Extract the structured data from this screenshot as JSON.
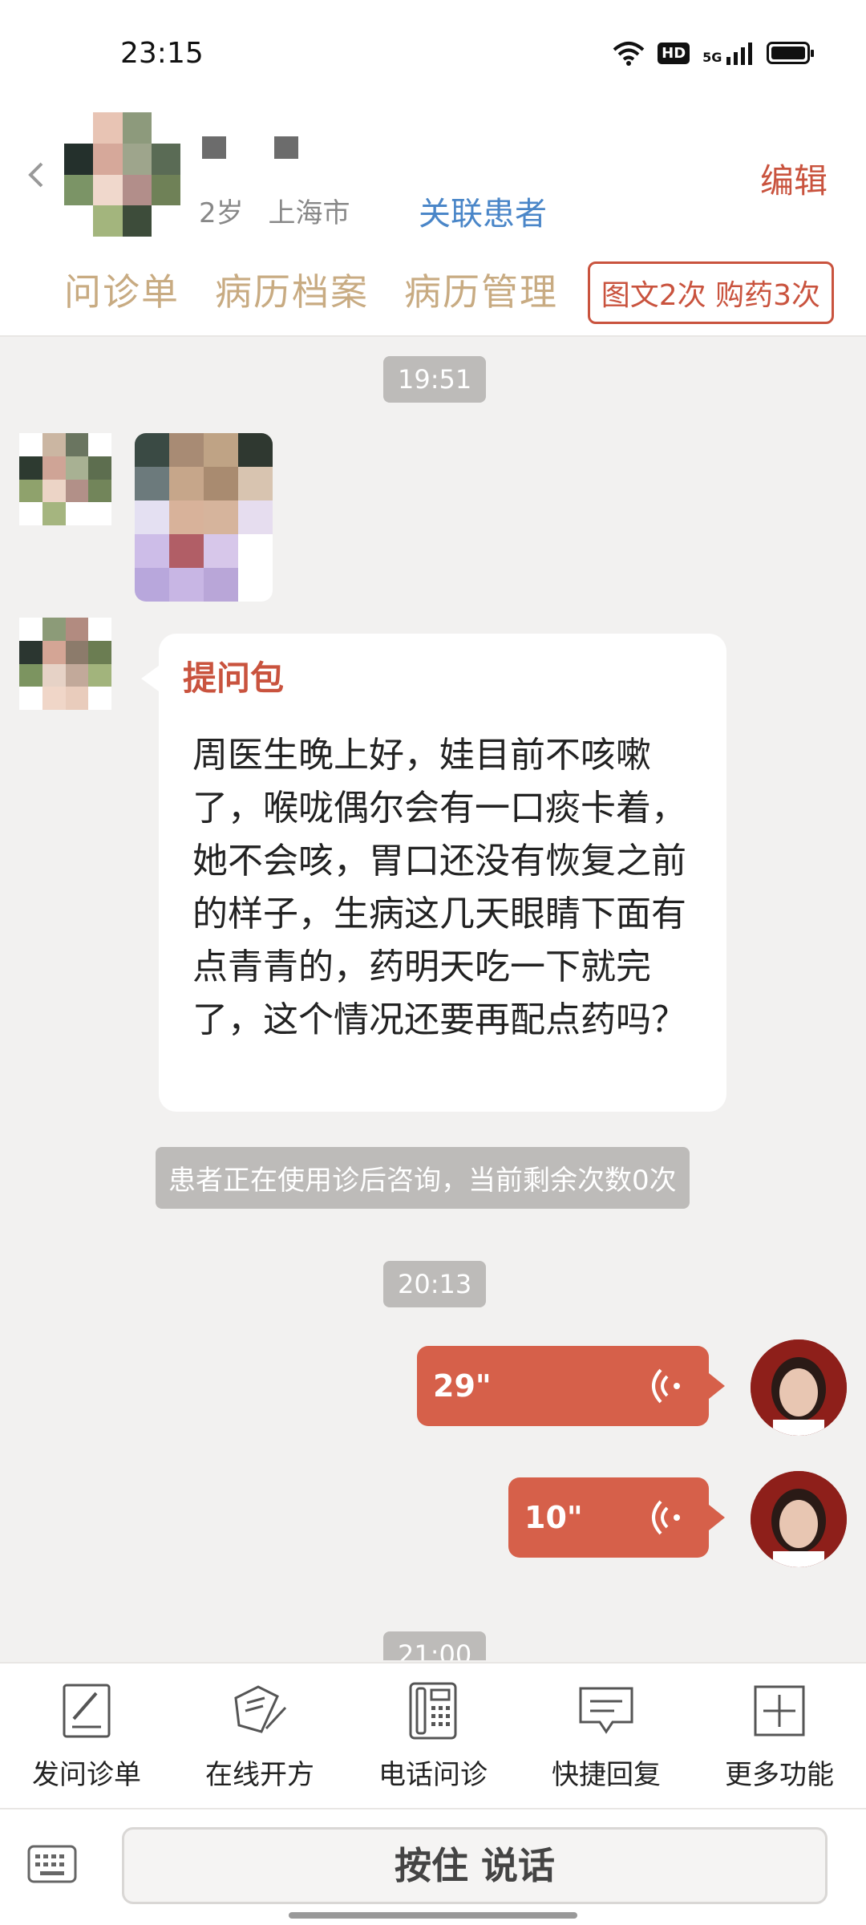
{
  "status_bar": {
    "time": "23:15",
    "hd": "HD",
    "network": "5G"
  },
  "header": {
    "age": "2岁",
    "city": "上海市",
    "link_patient": "关联患者",
    "edit": "编辑",
    "tabs": [
      "问诊单",
      "病历档案",
      "病历管理"
    ],
    "usage_tag": "图文2次 购药3次"
  },
  "chat": {
    "ts1": "19:51",
    "question_title": "提问包",
    "question_text": "周医生晚上好，娃目前不咳嗽了，喉咙偶尔会有一口痰卡着，她不会咳，胃口还没有恢复之前的样子，生病这几天眼睛下面有点青青的，药明天吃一下就完了，这个情况还要再配点药吗？",
    "system_note": "患者正在使用诊后咨询，当前剩余次数0次",
    "ts2": "20:13",
    "voice1": "29\"",
    "voice2": "10\"",
    "ts3": "21:00"
  },
  "toolbar": {
    "items": [
      {
        "label": "发问诊单",
        "icon": "form-pen-icon"
      },
      {
        "label": "在线开方",
        "icon": "prescription-icon"
      },
      {
        "label": "电话问诊",
        "icon": "phone-icon"
      },
      {
        "label": "快捷回复",
        "icon": "message-icon"
      },
      {
        "label": "更多功能",
        "icon": "plus-box-icon"
      }
    ]
  },
  "input": {
    "talk_button": "按住 说话"
  },
  "colors": {
    "accent": "#c9533e",
    "voice": "#d6604a",
    "tab": "#c8ab82",
    "link": "#4a86c8"
  }
}
